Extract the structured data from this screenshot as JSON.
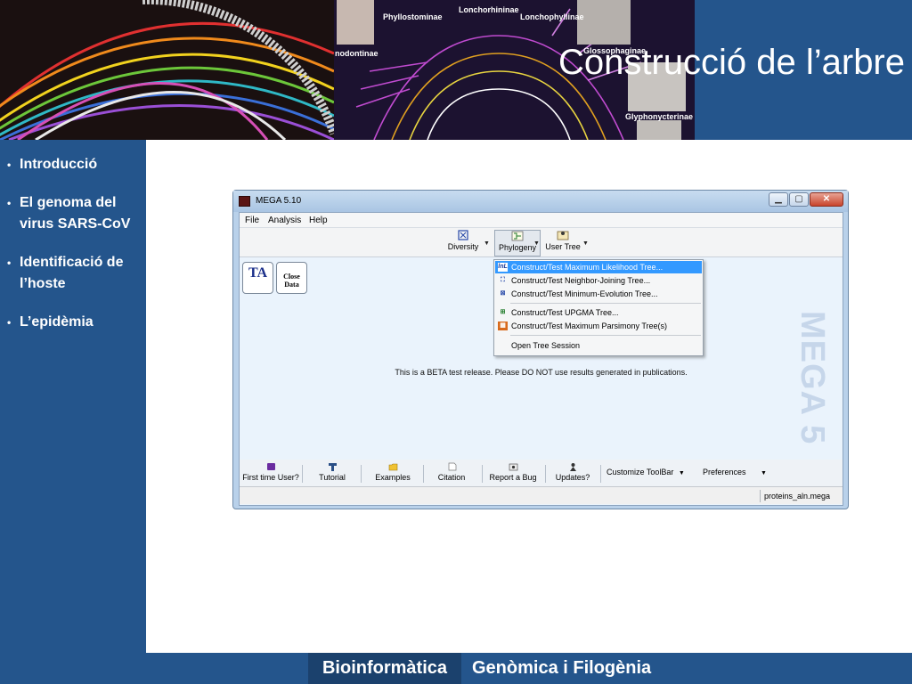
{
  "slide": {
    "title": "Construcció de l’arbre",
    "nav": [
      {
        "label": "Introducció",
        "active": false
      },
      {
        "label": "El genoma del\nvirus SARS-CoV",
        "active": false
      },
      {
        "label": "Identificació de\nl’hoste",
        "active": false
      },
      {
        "label": "L’epidèmia",
        "active": true
      }
    ],
    "banner_labels": [
      "Phyllostominae",
      "Lonchorhininae",
      "Lonchophyllinae",
      "nodontinae",
      "Glossophaginae",
      "Glyphonycterinae"
    ],
    "footer": {
      "left": "Bioinformàtica",
      "right": "Genòmica i Filogènia"
    }
  },
  "window": {
    "title": "MEGA 5.10",
    "menubar": [
      "File",
      "Analysis",
      "Help"
    ],
    "toolbar": {
      "diversity": "Diversity",
      "phylogeny": "Phylogeny",
      "user_tree": "User Tree"
    },
    "tiles": {
      "ta": "TA",
      "close_data": "Close\nData"
    },
    "phylogeny_menu": [
      {
        "label": "Construct/Test Maximum Likelihood Tree...",
        "icon": "ml-icon",
        "highlighted": true
      },
      {
        "label": "Construct/Test Neighbor-Joining Tree...",
        "icon": "nj-icon",
        "highlighted": false
      },
      {
        "label": "Construct/Test Minimum-Evolution Tree...",
        "icon": "me-icon",
        "highlighted": false
      },
      {
        "label": "Construct/Test UPGMA Tree...",
        "icon": "upgma-icon",
        "highlighted": false
      },
      {
        "label": "Construct/Test Maximum Parsimony Tree(s)",
        "icon": "mp-icon",
        "highlighted": false
      },
      {
        "label": "Open Tree Session",
        "icon": "",
        "highlighted": false
      }
    ],
    "watermark": "MEGA 5",
    "beta_notice": "This is a BETA test release. Please DO NOT use results generated in publications.",
    "bottom_toolbar": {
      "first_time": "First time User?",
      "tutorial": "Tutorial",
      "examples": "Examples",
      "citation": "Citation",
      "report_bug": "Report a Bug",
      "updates": "Updates?",
      "customize": "Customize ToolBar",
      "preferences": "Preferences"
    },
    "status_file": "proteins_aln.mega"
  },
  "colors": {
    "slide_blue": "#24558c",
    "footer_dark": "#1b416d",
    "menu_highlight": "#3399ff",
    "window_client": "#eaf3fc"
  }
}
